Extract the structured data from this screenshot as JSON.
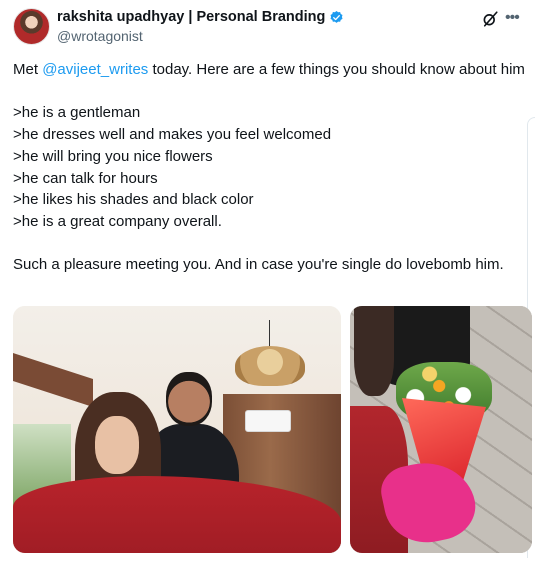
{
  "tweet": {
    "display_name": "rakshita upadhyay | Personal Branding",
    "handle": "@wrotagonist",
    "verified": true,
    "text_prefix": "Met ",
    "mention": "@avijeet_writes",
    "text_after_mention": " today. Here are a few things you should know about him\n\n>he is a gentleman\n>he dresses well and makes you feel welcomed\n>he will bring you nice flowers\n>he can talk for hours\n>he likes his shades and black color\n>he is a great company overall.\n\nSuch a pleasure meeting you. And in case you're single do lovebomb him.",
    "photos": [
      {
        "name": "selfie-photo"
      },
      {
        "name": "flowers-photo"
      }
    ]
  },
  "icons": {
    "verified": "verified-badge-icon",
    "grok": "grok-icon",
    "more": "more-icon"
  },
  "colors": {
    "text": "#0f1419",
    "secondary": "#536471",
    "accent": "#1d9bf0"
  }
}
